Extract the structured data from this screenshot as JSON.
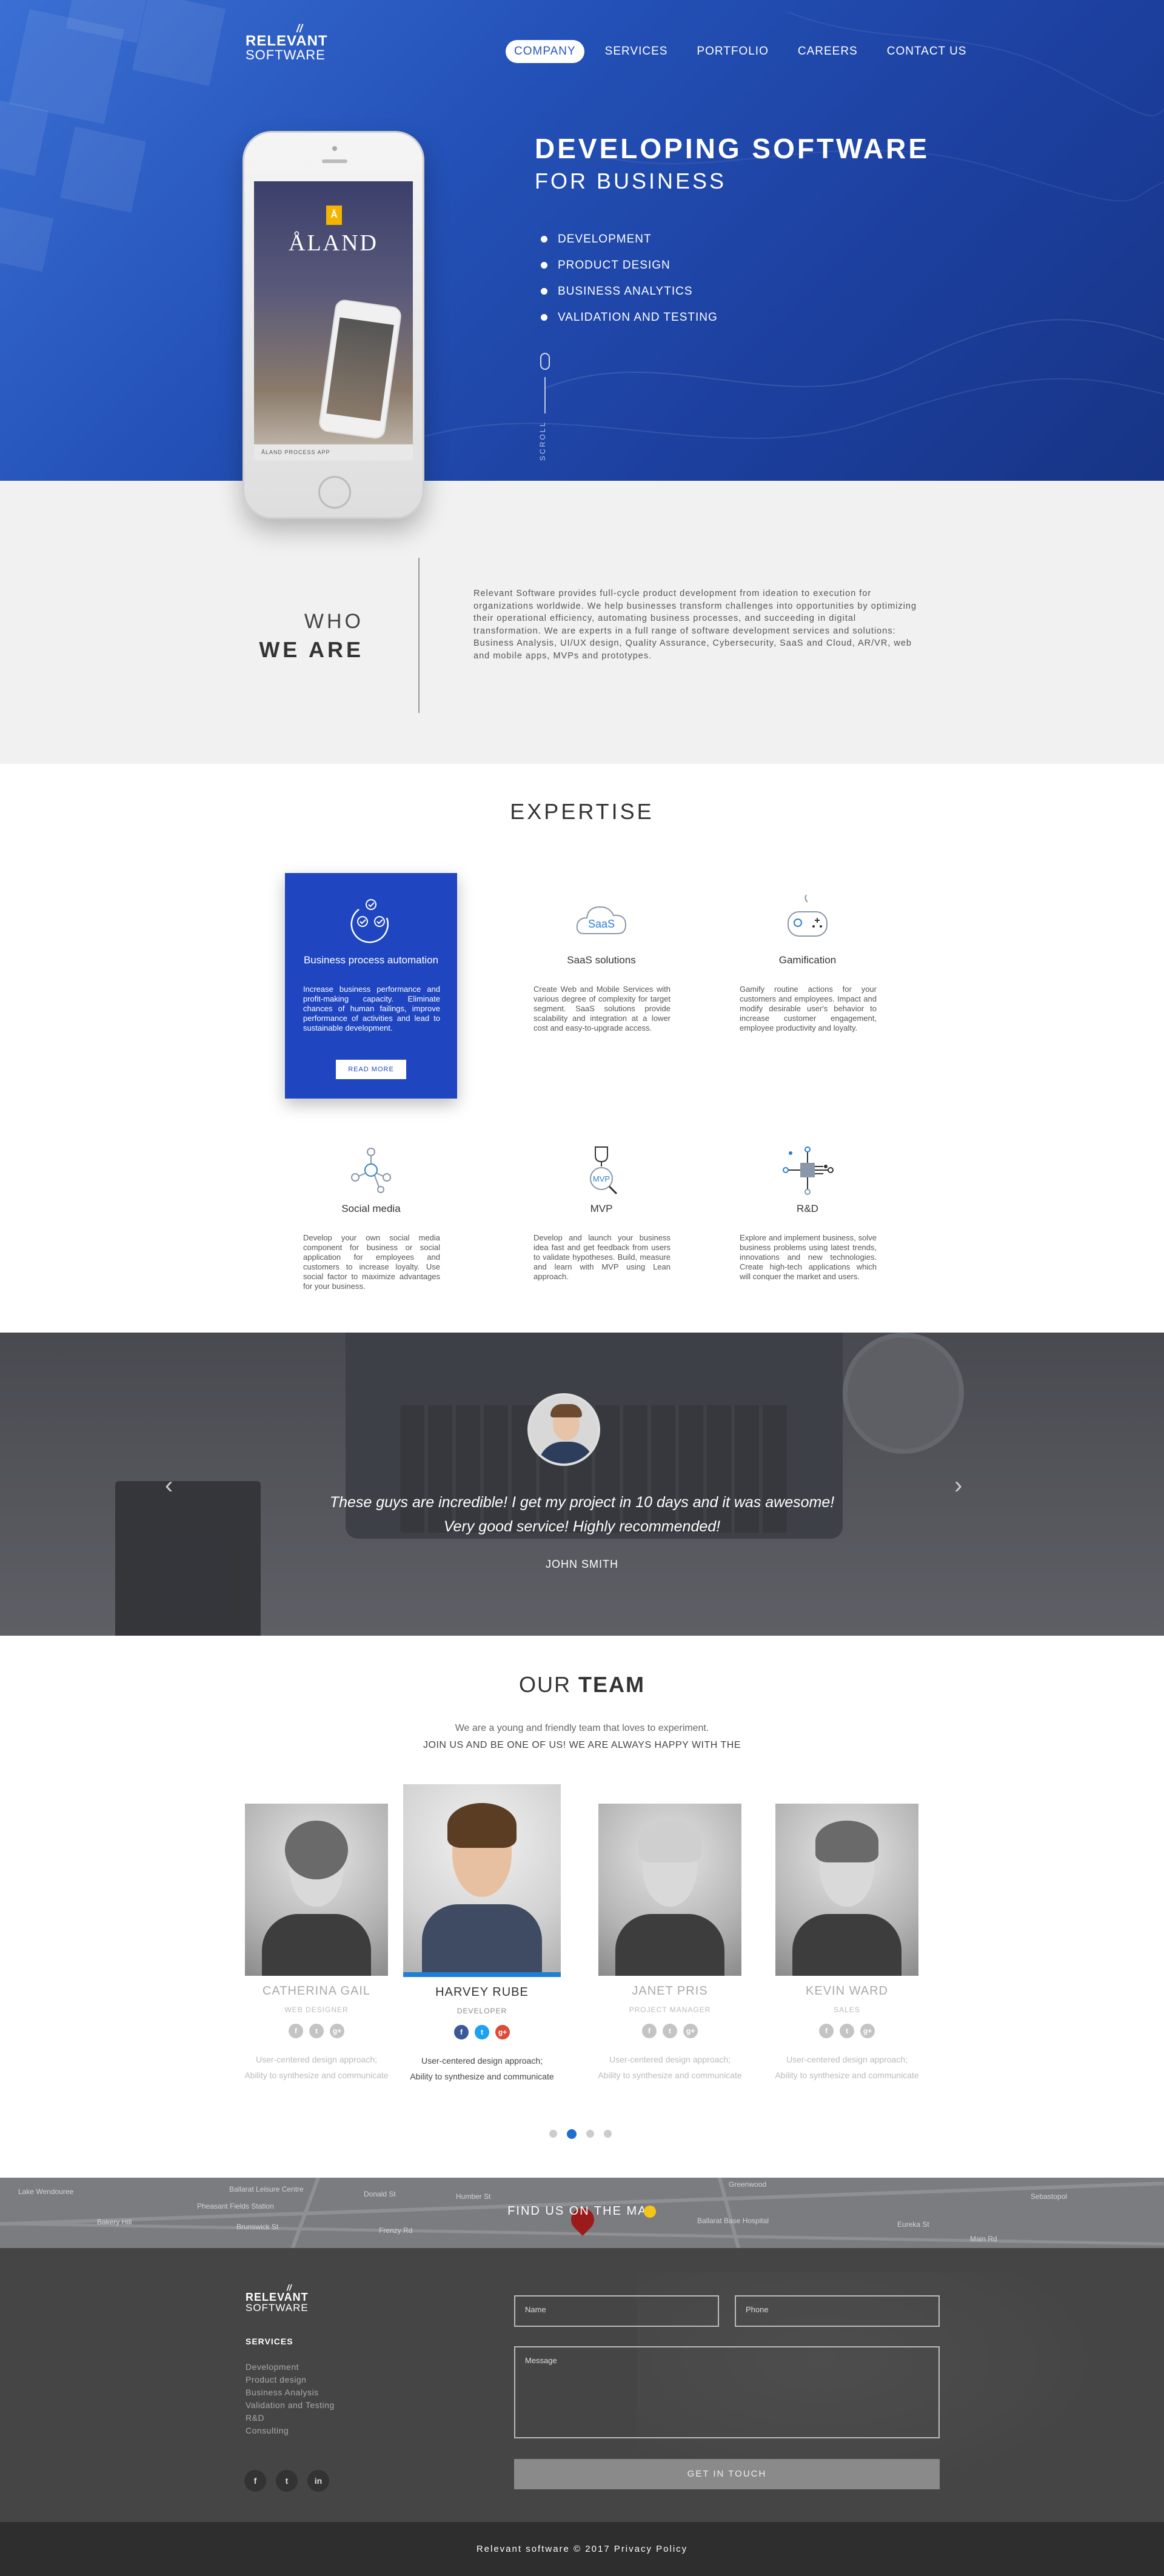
{
  "brand": {
    "line1": "RELEVANT",
    "line2": "SOFTWARE"
  },
  "nav": [
    {
      "label": "COMPANY",
      "active": true
    },
    {
      "label": "SERVICES"
    },
    {
      "label": "PORTFOLIO"
    },
    {
      "label": "CAREERS"
    },
    {
      "label": "CONTACT US"
    }
  ],
  "hero": {
    "title": "DEVELOPING SOFTWARE",
    "subtitle": "FOR BUSINESS",
    "bullets": [
      "DEVELOPMENT",
      "PRODUCT DESIGN",
      "BUSINESS ANALYTICS",
      "VALIDATION AND TESTING"
    ],
    "scroll_label": "SCROLL",
    "phone_brand": "ÅLAND",
    "phone_badge": "Å",
    "phone_footer": "ÅLAND PROCESS APP"
  },
  "who": {
    "title1": "WHO",
    "title2": "WE ARE",
    "text": "Relevant Software provides full-cycle product development from ideation to execution for organizations worldwide. We help businesses transform challenges into opportunities by optimizing their operational efficiency, automating business processes, and succeeding in digital transformation. We are experts in a full range of software development services and solutions: Business Analysis, UI/UX design, Quality Assurance, Cybersecurity, SaaS and Cloud, AR/VR, web and mobile apps, MVPs and prototypes."
  },
  "expertise": {
    "title": "EXPERTISE",
    "cards": [
      {
        "title": "Business process automation",
        "text": "Increase business performance and profit-making capacity. Eliminate chances of human failings, improve performance of activities and lead to sustainable development.",
        "button": "READ MORE",
        "icon": "automation-icon"
      },
      {
        "title": "SaaS solutions",
        "text": "Create Web and Mobile Services with various degree of complexity for target segment. SaaS solutions provide scalability and integration at a lower cost and easy-to-upgrade access.",
        "icon": "saas-cloud-icon",
        "icon_text": "SaaS"
      },
      {
        "title": "Gamification",
        "text": "Gamify routine actions for your customers and employees. Impact and modify desirable user's behavior to increase customer engagement, employee productivity and loyalty.",
        "icon": "gamepad-icon"
      },
      {
        "title": "Social media",
        "text": "Develop your own social media component for business or social application for employees and customers to increase loyalty. Use social factor to maximize advantages for your business.",
        "icon": "social-network-icon"
      },
      {
        "title": "MVP",
        "text": "Develop and launch your business idea fast and get feedback from users to validate hypotheses. Build, measure and learn with MVP using Lean approach.",
        "icon": "mvp-trophy-icon",
        "icon_text": "MVP"
      },
      {
        "title": "R&D",
        "text": "Explore and implement business, solve business problems using latest trends, innovations and new technologies. Create high-tech applications which will conquer the market and users.",
        "icon": "rnd-circuit-icon"
      }
    ]
  },
  "testimonial": {
    "line1": "These guys are incredible! I get my project in 10 days and it was awesome!",
    "line2": "Very good service! Highly recommended!",
    "author": "JOHN SMITH",
    "prev": "‹",
    "next": "›"
  },
  "team": {
    "title_light": "OUR",
    "title_bold": "TEAM",
    "sub1": "We are a young and friendly team that loves to experiment.",
    "sub2": "JOIN US AND BE ONE OF US! WE ARE ALWAYS HAPPY WITH THE",
    "members": [
      {
        "name": "CATHERINA GAIL",
        "role": "WEB DESIGNER",
        "desc1": "User-centered design approach;",
        "desc2": "Ability to synthesize and communicate"
      },
      {
        "name": "HARVEY RUBE",
        "role": "DEVELOPER",
        "desc1": "User-centered design approach;",
        "desc2": "Ability to synthesize and communicate",
        "featured": true
      },
      {
        "name": "JANET PRIS",
        "role": "PROJECT MANAGER",
        "desc1": "User-centered design approach;",
        "desc2": "Ability to synthesize and communicate"
      },
      {
        "name": "KEVIN WARD",
        "role": "SALES",
        "desc1": "User-centered design approach;",
        "desc2": "Ability to synthesize and communicate"
      }
    ],
    "social": {
      "f": "f",
      "t": "t",
      "g": "g+"
    },
    "dots_active": 1
  },
  "map": {
    "title": "FIND US ON THE MAP",
    "labels": [
      "Ballarat Leisure Centre",
      "Pheasant Fields Station",
      "Humber St",
      "Brunswick St",
      "Greenwood",
      "Donald St",
      "Frenzy Rd",
      "Bakery Hill",
      "Eureka St",
      "Sebastopol",
      "Ballarat Base Hospital",
      "Lake Wendouree",
      "Main Rd"
    ]
  },
  "footer": {
    "services_title": "SERVICES",
    "services": [
      "Development",
      "Product design",
      "Business Analysis",
      "Validation and Testing",
      "R&D",
      "Consulting"
    ],
    "name_placeholder": "Name",
    "phone_placeholder": "Phone",
    "message_placeholder": "Message",
    "button": "GET IN TOUCH",
    "social": [
      "f",
      "t",
      "in"
    ],
    "copyright": "Relevant software © 2017 Privacy Policy"
  },
  "colors": {
    "hero_blue": "#2452b8",
    "accent_blue": "#1f46c0",
    "team_accent": "#1e7fd6",
    "footer_bg": "#454545"
  }
}
